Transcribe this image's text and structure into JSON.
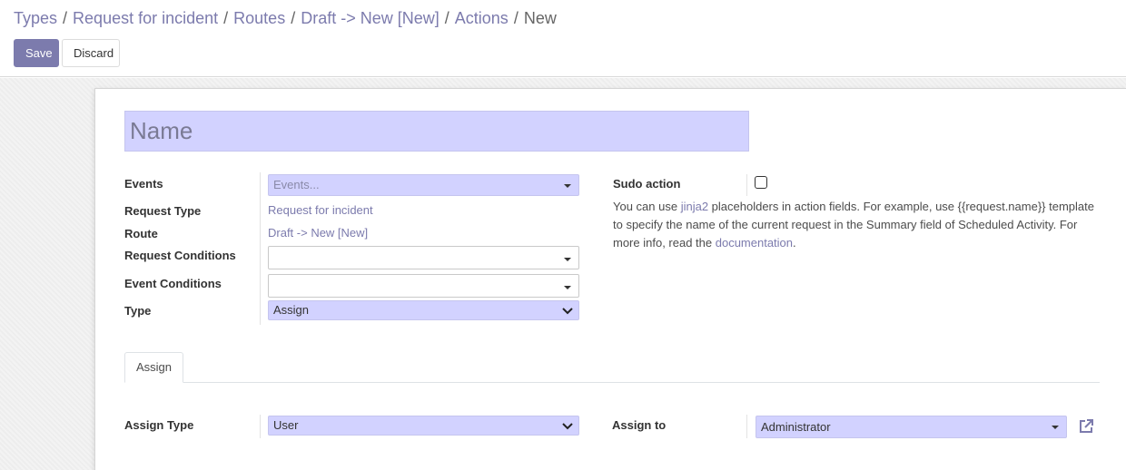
{
  "breadcrumb": {
    "items": [
      "Types",
      "Request for incident",
      "Routes",
      "Draft -> New [New]",
      "Actions"
    ],
    "separator": "/",
    "current": "New"
  },
  "toolbar": {
    "save_label": "Save",
    "discard_label": "Discard"
  },
  "form": {
    "name_placeholder": "Name",
    "events": {
      "label": "Events",
      "placeholder": "Events..."
    },
    "request_type": {
      "label": "Request Type",
      "value": "Request for incident"
    },
    "route": {
      "label": "Route",
      "value": "Draft -> New [New]"
    },
    "request_conditions": {
      "label": "Request Conditions",
      "value": ""
    },
    "event_conditions": {
      "label": "Event Conditions",
      "value": ""
    },
    "type": {
      "label": "Type",
      "value": "Assign"
    },
    "sudo_action": {
      "label": "Sudo action",
      "checked": false
    },
    "help": {
      "part1": "You can use ",
      "link1": "jinja2",
      "part2": " placeholders in action fields. For example, use {{request.name}} template to specify the name of the current request in the Summary field of Scheduled Activity. For more info, read the ",
      "link2": "documentation",
      "part3": "."
    }
  },
  "tabs": [
    {
      "label": "Assign",
      "active": true
    }
  ],
  "assign": {
    "assign_type": {
      "label": "Assign Type",
      "value": "User"
    },
    "assign_to": {
      "label": "Assign to",
      "value": "Administrator"
    }
  },
  "colors": {
    "accent": "#7c7bad",
    "required_bg": "#d2d2ff"
  },
  "icons": [
    "caret-down-icon",
    "chevron-down-icon",
    "external-link-icon"
  ]
}
